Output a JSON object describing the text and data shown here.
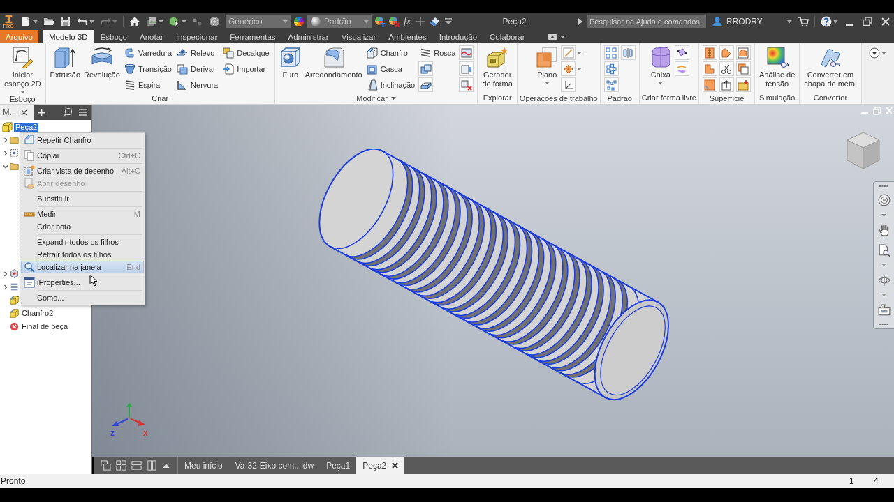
{
  "title_bar": {
    "logo_badge": "PRO",
    "material": "Genérico",
    "appearance": "Padrão",
    "formula": "fx",
    "title": "Peça2",
    "search": {
      "placeholder": "Pesquisar na Ajuda e comandos."
    },
    "user": "RRODRY"
  },
  "menu_tabs": [
    {
      "label": "Arquivo",
      "kind": "file",
      "selected": false
    },
    {
      "label": "Modelo 3D",
      "kind": "tab",
      "selected": true
    },
    {
      "label": "Esboço",
      "kind": "tab",
      "selected": false
    },
    {
      "label": "Anotar",
      "kind": "tab",
      "selected": false
    },
    {
      "label": "Inspecionar",
      "kind": "tab",
      "selected": false
    },
    {
      "label": "Ferramentas",
      "kind": "tab",
      "selected": false
    },
    {
      "label": "Administrar",
      "kind": "tab",
      "selected": false
    },
    {
      "label": "Visualizar",
      "kind": "tab",
      "selected": false
    },
    {
      "label": "Ambientes",
      "kind": "tab",
      "selected": false
    },
    {
      "label": "Introdução",
      "kind": "tab",
      "selected": false
    },
    {
      "label": "Colaborar",
      "kind": "tab",
      "selected": false
    }
  ],
  "ribbon": {
    "panels": [
      {
        "title": "Esboço",
        "title_dropdown": false,
        "groups": [
          {
            "kind": "large",
            "label": "Iniciar\nesboço 2D",
            "dropdown": true
          }
        ]
      },
      {
        "title": "Criar",
        "title_dropdown": false,
        "groups": [
          {
            "kind": "large",
            "label": "Extrusão",
            "dropdown": false
          },
          {
            "kind": "large",
            "label": "Revolução",
            "dropdown": false
          },
          {
            "kind": "column",
            "tools": [
              {
                "kind": "small",
                "label": "Varredura"
              },
              {
                "kind": "small",
                "label": "Transição"
              },
              {
                "kind": "small",
                "label": "Espiral"
              }
            ]
          },
          {
            "kind": "column",
            "tools": [
              {
                "kind": "small",
                "label": "Relevo"
              },
              {
                "kind": "small",
                "label": "Derivar"
              },
              {
                "kind": "small",
                "label": "Nervura"
              }
            ]
          },
          {
            "kind": "column",
            "tools": [
              {
                "kind": "small",
                "label": "Decalque"
              },
              {
                "kind": "small",
                "label": "Importar"
              }
            ]
          }
        ]
      },
      {
        "title": "Modificar",
        "title_dropdown": true,
        "groups": [
          {
            "kind": "large",
            "label": "Furo",
            "dropdown": false
          },
          {
            "kind": "large",
            "label": "Arredondamento",
            "dropdown": false
          },
          {
            "kind": "column",
            "tools": [
              {
                "kind": "small",
                "label": "Chanfro"
              },
              {
                "kind": "small",
                "label": "Casca"
              },
              {
                "kind": "small",
                "label": "Inclinação"
              }
            ]
          },
          {
            "kind": "column",
            "tools": [
              {
                "kind": "small",
                "label": "Rosca"
              },
              {
                "kind": "icon"
              },
              {
                "kind": "icon"
              }
            ]
          },
          {
            "kind": "column",
            "tools": [
              {
                "kind": "icon"
              },
              {
                "kind": "icon"
              },
              {
                "kind": "icon"
              }
            ]
          }
        ]
      },
      {
        "title": "Explorar",
        "title_dropdown": false,
        "groups": [
          {
            "kind": "large",
            "label": "Gerador\nde forma",
            "dropdown": false
          }
        ]
      },
      {
        "title": "Operações de trabalho",
        "title_dropdown": false,
        "groups": [
          {
            "kind": "large",
            "label": "Plano",
            "dropdown": true
          },
          {
            "kind": "column",
            "tools": [
              {
                "kind": "icon",
                "dropdown": true
              },
              {
                "kind": "icon",
                "dropdown": true
              },
              {
                "kind": "icon",
                "dropdown": false
              }
            ]
          }
        ]
      },
      {
        "title": "Padrão",
        "title_dropdown": false,
        "groups": [
          {
            "kind": "column",
            "tools": [
              {
                "kind": "icon"
              },
              {
                "kind": "icon"
              },
              {
                "kind": "icon"
              }
            ]
          },
          {
            "kind": "column",
            "tools": [
              {
                "kind": "icon"
              }
            ]
          }
        ]
      },
      {
        "title": "Criar forma livre",
        "title_dropdown": false,
        "groups": [
          {
            "kind": "large",
            "label": "Caixa",
            "dropdown": true
          },
          {
            "kind": "column",
            "tools": [
              {
                "kind": "icon"
              },
              {
                "kind": "icon"
              }
            ]
          }
        ]
      },
      {
        "title": "Superfície",
        "title_dropdown": false,
        "groups": [
          {
            "kind": "column",
            "tools": [
              {
                "kind": "icon"
              },
              {
                "kind": "icon"
              },
              {
                "kind": "icon"
              }
            ]
          },
          {
            "kind": "column",
            "tools": [
              {
                "kind": "icon"
              },
              {
                "kind": "icon"
              },
              {
                "kind": "icon"
              }
            ]
          },
          {
            "kind": "column",
            "tools": [
              {
                "kind": "icon"
              },
              {
                "kind": "icon"
              },
              {
                "kind": "icon"
              }
            ]
          }
        ]
      },
      {
        "title": "Simulação",
        "title_dropdown": false,
        "groups": [
          {
            "kind": "large",
            "label": "Análise de\ntensão",
            "dropdown": false
          }
        ]
      },
      {
        "title": "Converter",
        "title_dropdown": false,
        "groups": [
          {
            "kind": "large",
            "label": "Converter em\nchapa de metal",
            "dropdown": false
          }
        ]
      }
    ]
  },
  "browser": {
    "tab_label": "M...",
    "tree": {
      "kind": "part",
      "label": "Peça2",
      "selected": true,
      "children": [
        {
          "kind": "folder",
          "expanded": false
        },
        {
          "kind": "origin",
          "expanded": false
        },
        {
          "kind": "folder",
          "expanded": true
        },
        {
          "kind": "feature",
          "expanded": false
        },
        {
          "kind": "stack",
          "expanded": false
        },
        {
          "kind": "chamfer"
        },
        {
          "kind": "chamfer",
          "label": "Chanfro2",
          "selected": false
        },
        {
          "kind": "end",
          "label": "Final de peça",
          "selected": false
        }
      ]
    }
  },
  "context_menu": {
    "items": [
      {
        "kind": "item",
        "label": "Repetir Chanfro",
        "disabled": false,
        "selected": false
      },
      {
        "kind": "separator"
      },
      {
        "kind": "item",
        "label": "Copiar",
        "shortcut": "Ctrl+C",
        "disabled": false,
        "selected": false
      },
      {
        "kind": "separator"
      },
      {
        "kind": "item",
        "label": "Criar vista de desenho",
        "shortcut": "Alt+C",
        "disabled": false,
        "selected": false
      },
      {
        "kind": "item",
        "label": "Abrir desenho",
        "disabled": true,
        "selected": false
      },
      {
        "kind": "separator"
      },
      {
        "kind": "item",
        "label": "Substituir",
        "disabled": false,
        "selected": false
      },
      {
        "kind": "separator"
      },
      {
        "kind": "item",
        "label": "Medir",
        "shortcut": "M",
        "disabled": false,
        "selected": false
      },
      {
        "kind": "item",
        "label": "Criar nota",
        "disabled": false,
        "selected": false
      },
      {
        "kind": "separator"
      },
      {
        "kind": "item",
        "label": "Expandir todos os filhos",
        "disabled": false,
        "selected": false
      },
      {
        "kind": "item",
        "label": "Retrair todos os filhos",
        "disabled": false,
        "selected": false
      },
      {
        "kind": "item",
        "label": "Localizar na janela",
        "shortcut": "End",
        "disabled": false,
        "selected": true
      },
      {
        "kind": "separator"
      },
      {
        "kind": "item",
        "label": "iProperties...",
        "disabled": false,
        "selected": false
      },
      {
        "kind": "separator"
      },
      {
        "kind": "item",
        "label": "Como...",
        "disabled": false,
        "selected": false
      }
    ]
  },
  "viewport": {
    "axis_labels": [
      {
        "label": "z",
        "color": "#2f45d6"
      },
      {
        "label": "x",
        "color": "#d83030"
      }
    ]
  },
  "document_tabs": [
    {
      "label": "Meu início",
      "selected": false
    },
    {
      "label": "Va-32-Eixo com...idw",
      "selected": false
    },
    {
      "label": "Peça1",
      "selected": false
    },
    {
      "label": "Peça2",
      "selected": true
    }
  ],
  "status_bar": {
    "message": "Pronto",
    "fields": [
      "1",
      "4"
    ]
  }
}
